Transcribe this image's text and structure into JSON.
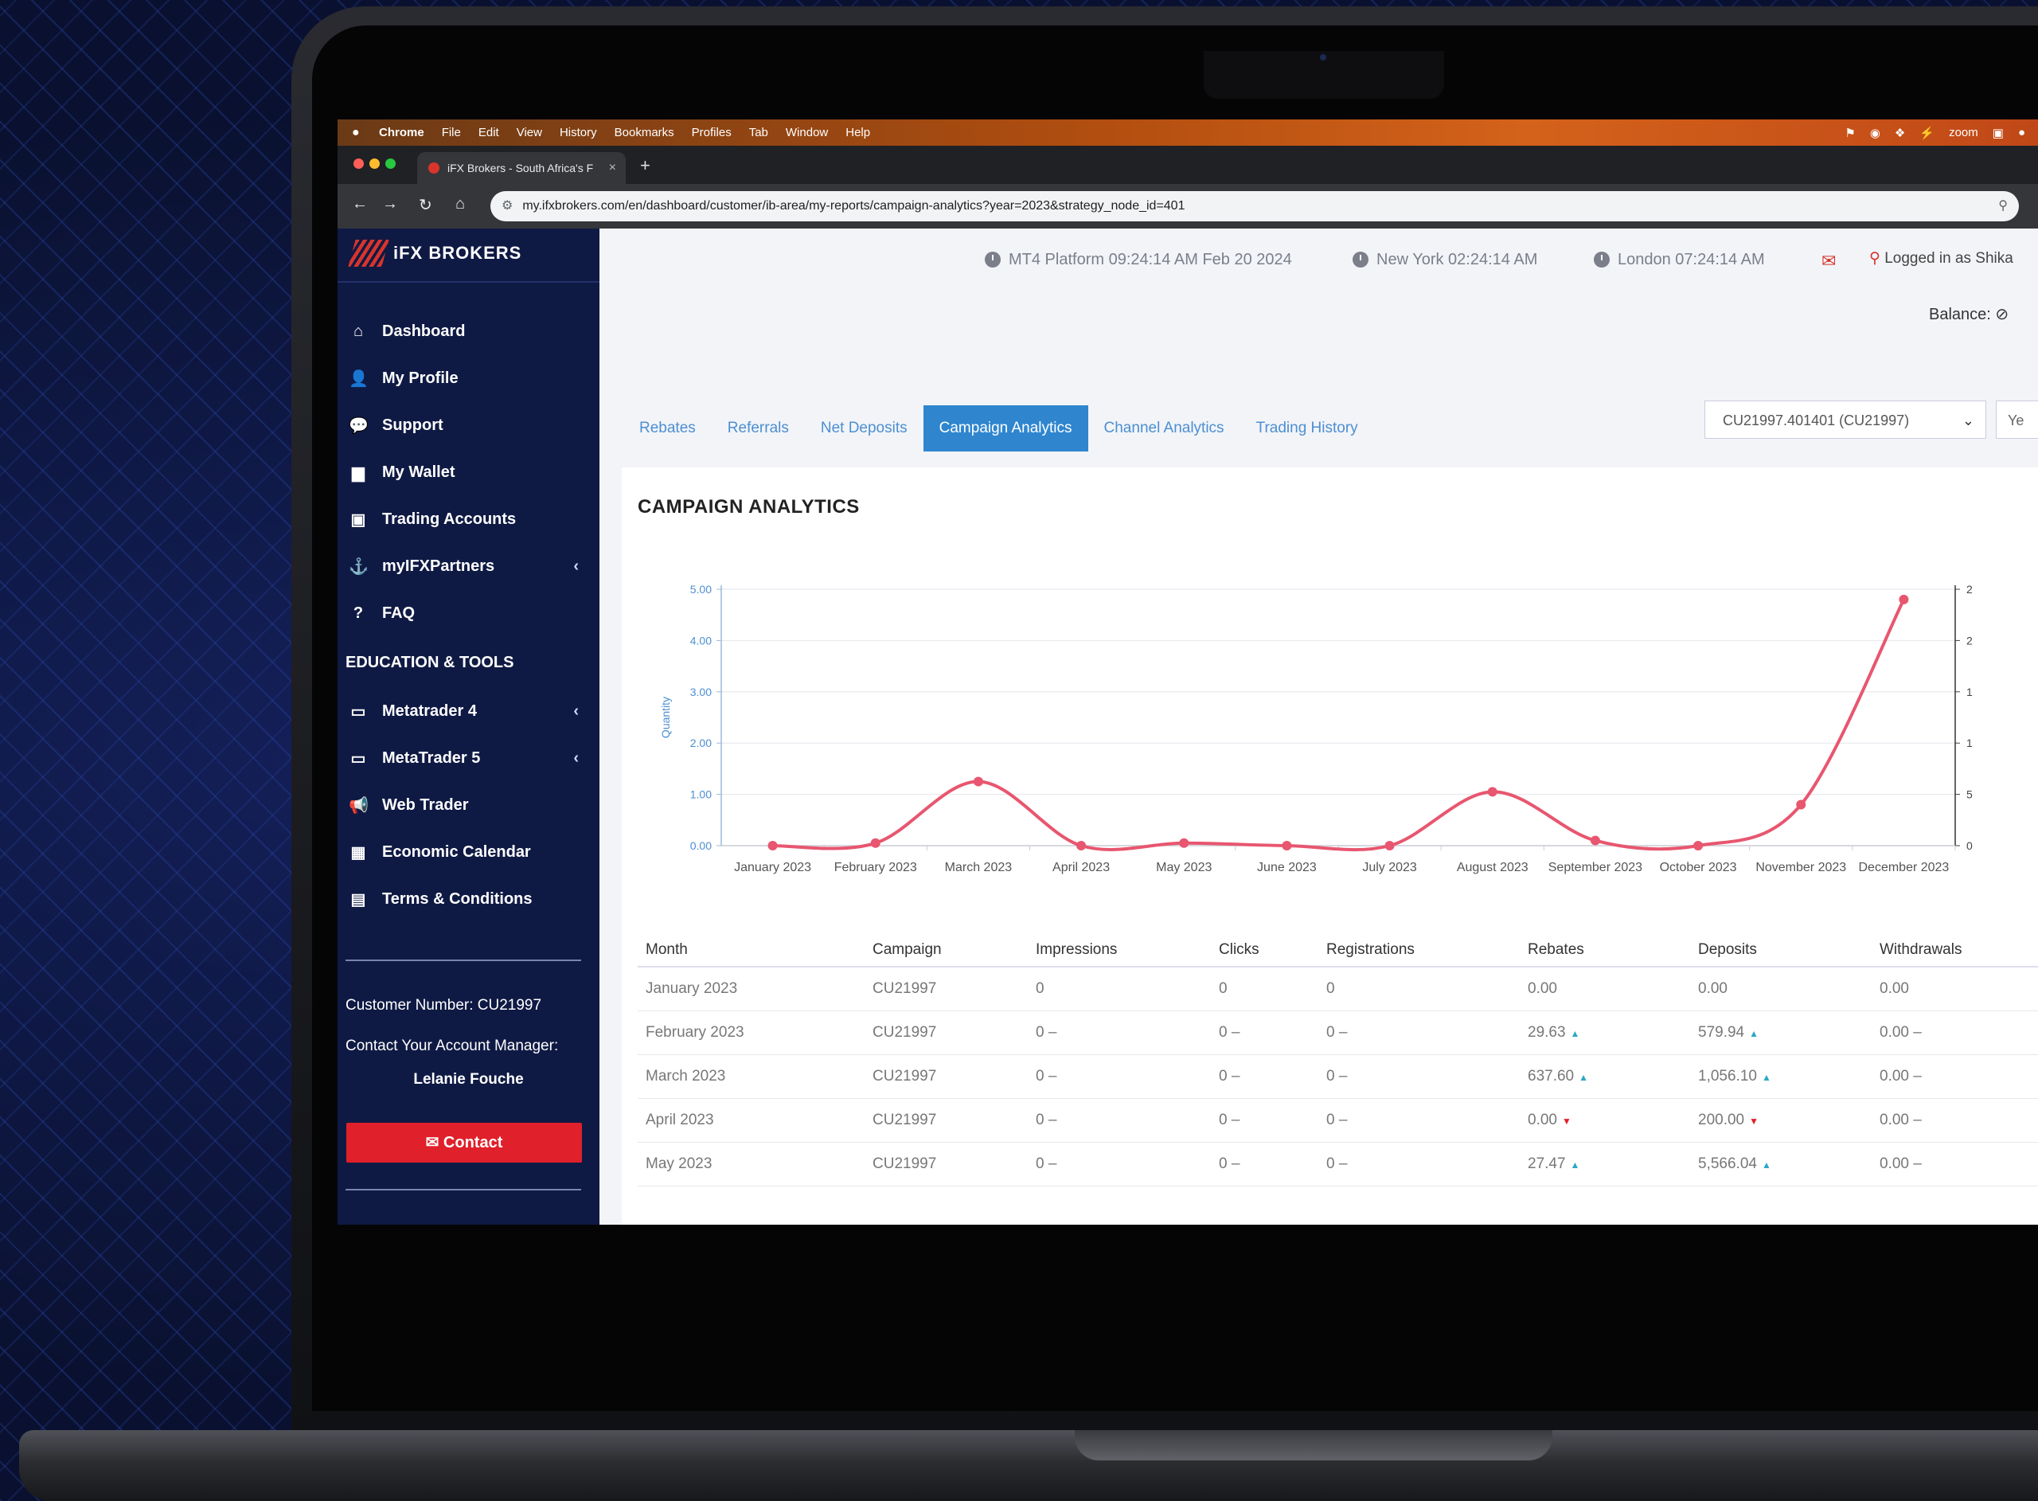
{
  "browser": {
    "menubar": {
      "app": "Chrome",
      "items": [
        "File",
        "Edit",
        "View",
        "History",
        "Bookmarks",
        "Profiles",
        "Tab",
        "Window",
        "Help"
      ],
      "right_text": "zoom"
    },
    "tab_title": "iFX Brokers - South Africa's F",
    "url": "my.ifxbrokers.com/en/dashboard/customer/ib-area/my-reports/campaign-analytics?year=2023&strategy_node_id=401"
  },
  "brand": {
    "name": "iFX BROKERS"
  },
  "sidebar": {
    "items": [
      {
        "label": "Dashboard",
        "icon": "home-icon",
        "glyph": "⌂"
      },
      {
        "label": "My Profile",
        "icon": "user-icon",
        "glyph": "👤"
      },
      {
        "label": "Support",
        "icon": "chat-icon",
        "glyph": "💬"
      },
      {
        "label": "My Wallet",
        "icon": "folder-icon",
        "glyph": "▆"
      },
      {
        "label": "Trading Accounts",
        "icon": "briefcase-icon",
        "glyph": "▣"
      },
      {
        "label": "myIFXPartners",
        "icon": "anchor-icon",
        "glyph": "⚓"
      },
      {
        "label": "FAQ",
        "icon": "question-icon",
        "glyph": "?"
      }
    ],
    "section_heading": "EDUCATION & TOOLS",
    "tools": [
      {
        "label": "Metatrader 4",
        "icon": "laptop-icon",
        "glyph": "▭"
      },
      {
        "label": "MetaTrader 5",
        "icon": "laptop-icon",
        "glyph": "▭"
      },
      {
        "label": "Web Trader",
        "icon": "megaphone-icon",
        "glyph": "📢"
      },
      {
        "label": "Economic Calendar",
        "icon": "calendar-icon",
        "glyph": "▦"
      },
      {
        "label": "Terms & Conditions",
        "icon": "document-icon",
        "glyph": "▤"
      }
    ],
    "customer_number": "Customer Number: CU21997",
    "manager_label": "Contact Your Account Manager:",
    "manager_name": "Lelanie Fouche",
    "contact_label": "✉ Contact"
  },
  "header": {
    "mt4": "MT4 Platform  09:24:14 AM  Feb 20 2024",
    "newyork": "New York  02:24:14 AM",
    "london": "London  07:24:14 AM",
    "logged_in": "Logged in as Shika",
    "balance_label": "Balance:"
  },
  "tabs": [
    "Rebates",
    "Referrals",
    "Net Deposits",
    "Campaign Analytics",
    "Channel Analytics",
    "Trading History"
  ],
  "active_tab": "Campaign Analytics",
  "account_select": "CU21997.401401 (CU21997)",
  "year_select": "Ye",
  "panel_title": "CAMPAIGN ANALYTICS",
  "chart_data": {
    "type": "line",
    "categories": [
      "January 2023",
      "February 2023",
      "March 2023",
      "April 2023",
      "May 2023",
      "June 2023",
      "July 2023",
      "August 2023",
      "September 2023",
      "October 2023",
      "November 2023",
      "December 2023"
    ],
    "series": [
      {
        "name": "",
        "values": [
          0,
          0.05,
          1.25,
          0,
          0.05,
          0,
          0,
          1.05,
          0.1,
          0,
          0.8,
          4.8
        ],
        "color": "#e8566f"
      }
    ],
    "ylabel": "Quantity",
    "ylim": [
      0,
      5
    ],
    "yticks": [
      "0.00",
      "1.00",
      "2.00",
      "3.00",
      "4.00",
      "5.00"
    ],
    "y2ticks": [
      "0",
      "5",
      "1",
      "1",
      "2",
      "2"
    ],
    "grid": true
  },
  "table": {
    "headers": [
      "Month",
      "Campaign",
      "Impressions",
      "Clicks",
      "Registrations",
      "Rebates",
      "Deposits",
      "Withdrawals"
    ],
    "rows": [
      {
        "month": "January 2023",
        "campaign": "CU21997",
        "impressions": "0",
        "clicks": "0",
        "registrations": "0",
        "rebates": "0.00",
        "rebates_trend": "",
        "deposits": "0.00",
        "deposits_trend": "",
        "withdrawals": "0.00",
        "w_trend": ""
      },
      {
        "month": "February 2023",
        "campaign": "CU21997",
        "impressions": "0 –",
        "clicks": "0 –",
        "registrations": "0 –",
        "rebates": "29.63",
        "rebates_trend": "▲",
        "deposits": "579.94",
        "deposits_trend": "▲",
        "withdrawals": "0.00 –",
        "w_trend": ""
      },
      {
        "month": "March 2023",
        "campaign": "CU21997",
        "impressions": "0 –",
        "clicks": "0 –",
        "registrations": "0 –",
        "rebates": "637.60",
        "rebates_trend": "▲",
        "deposits": "1,056.10",
        "deposits_trend": "▲",
        "withdrawals": "0.00 –",
        "w_trend": ""
      },
      {
        "month": "April 2023",
        "campaign": "CU21997",
        "impressions": "0 –",
        "clicks": "0 –",
        "registrations": "0 –",
        "rebates": "0.00",
        "rebates_trend": "▼",
        "deposits": "200.00",
        "deposits_trend": "▼",
        "withdrawals": "0.00 –",
        "w_trend": ""
      },
      {
        "month": "May 2023",
        "campaign": "CU21997",
        "impressions": "0 –",
        "clicks": "0 –",
        "registrations": "0 –",
        "rebates": "27.47",
        "rebates_trend": "▲",
        "deposits": "5,566.04",
        "deposits_trend": "▲",
        "withdrawals": "0.00 –",
        "w_trend": ""
      }
    ]
  },
  "colors": {
    "sidebar": "#0f1a44",
    "accent": "#2f86cf",
    "contact": "#e0202a",
    "line": "#e8566f",
    "up": "#2aa8c8",
    "down": "#e0202a"
  }
}
